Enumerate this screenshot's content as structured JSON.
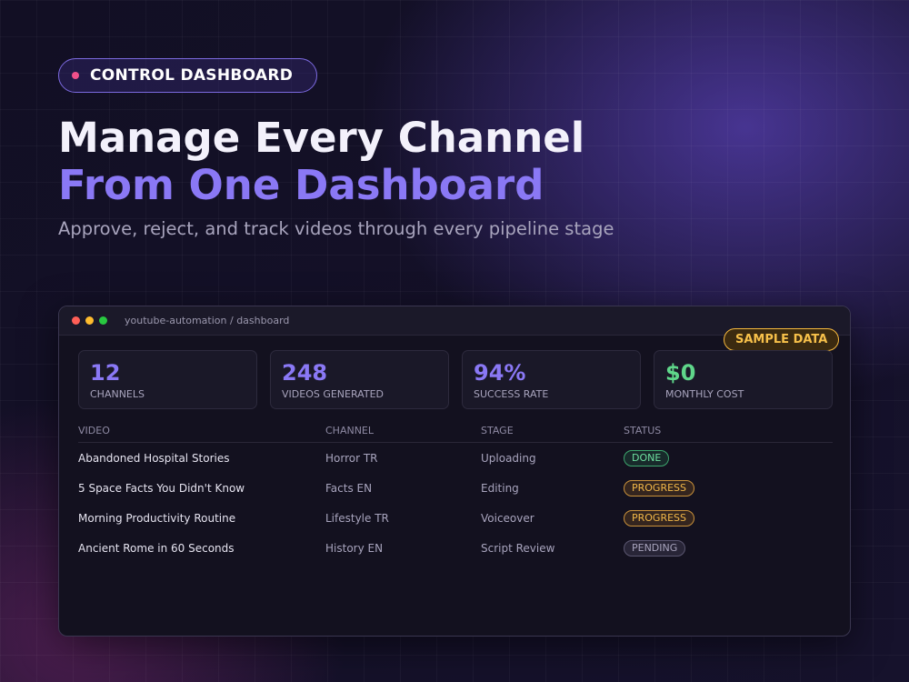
{
  "badge": {
    "label": "CONTROL DASHBOARD"
  },
  "hero": {
    "line1": "Manage Every Channel",
    "line2": "From One Dashboard",
    "subtitle": "Approve, reject, and track videos through every pipeline stage"
  },
  "window": {
    "path": "youtube-automation / dashboard",
    "sample_badge": "SAMPLE DATA"
  },
  "stats": [
    {
      "value": "12",
      "label": "CHANNELS"
    },
    {
      "value": "248",
      "label": "VIDEOS GENERATED"
    },
    {
      "value": "94%",
      "label": "SUCCESS RATE"
    },
    {
      "value": "$0",
      "label": "MONTHLY COST"
    }
  ],
  "table": {
    "headers": [
      "VIDEO",
      "CHANNEL",
      "STAGE",
      "STATUS"
    ],
    "rows": [
      {
        "video": "Abandoned Hospital Stories",
        "channel": "Horror TR",
        "stage": "Uploading",
        "status": "DONE"
      },
      {
        "video": "5 Space Facts You Didn't Know",
        "channel": "Facts EN",
        "stage": "Editing",
        "status": "PROGRESS"
      },
      {
        "video": "Morning Productivity Routine",
        "channel": "Lifestyle TR",
        "stage": "Voiceover",
        "status": "PROGRESS"
      },
      {
        "video": "Ancient Rome in 60 Seconds",
        "channel": "History EN",
        "stage": "Script Review",
        "status": "PENDING"
      }
    ]
  },
  "colors": {
    "accent": "#8a78f5",
    "success": "#5fd68a",
    "warning": "#f2b848",
    "badge_dot": "#f0508a"
  }
}
